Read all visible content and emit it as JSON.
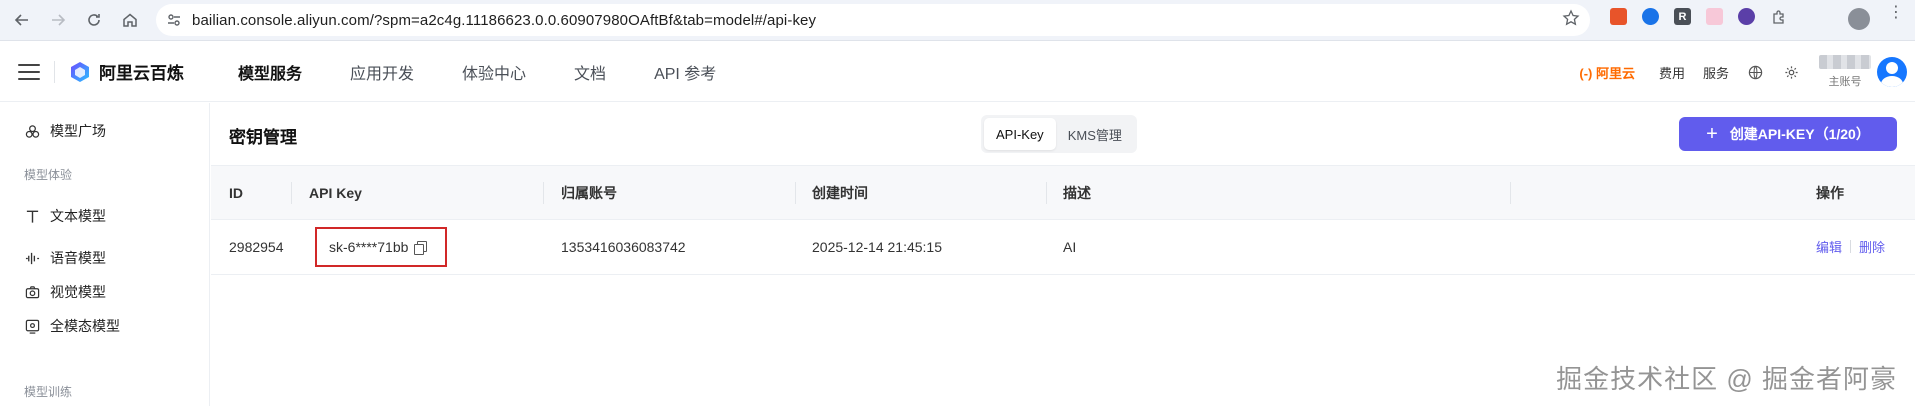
{
  "browser": {
    "url": "bailian.console.aliyun.com/?spm=a2c4g.11186623.0.0.60907980OAftBf&tab=model#/api-key",
    "ext_r_label": "R"
  },
  "header": {
    "logo_text": "阿里云百炼",
    "nav": [
      "模型服务",
      "应用开发",
      "体验中心",
      "文档",
      "API 参考"
    ],
    "aliyun_badge": "(-) 阿里云",
    "links": {
      "billing": "费用",
      "service": "服务"
    },
    "account_sub": "主账号"
  },
  "sidebar": {
    "items": [
      {
        "label": "模型广场",
        "icon": "model-plaza-icon"
      },
      {
        "label": "文本模型",
        "icon": "text-icon"
      },
      {
        "label": "语音模型",
        "icon": "audio-wave-icon"
      },
      {
        "label": "视觉模型",
        "icon": "camera-icon"
      },
      {
        "label": "全模态模型",
        "icon": "omni-icon"
      }
    ],
    "groups": [
      "模型体验",
      "模型训练"
    ]
  },
  "main": {
    "title": "密钥管理",
    "tabs": [
      {
        "label": "API-Key",
        "active": true
      },
      {
        "label": "KMS管理",
        "active": false
      }
    ],
    "create_button": "创建API-KEY（1/20）",
    "table": {
      "columns": [
        "ID",
        "API Key",
        "归属账号",
        "创建时间",
        "描述",
        "操作"
      ],
      "rows": [
        {
          "id": "2982954",
          "api_key": "sk-6****71bb",
          "account": "1353416036083742",
          "created": "2025-12-14 21:45:15",
          "desc": "AI",
          "edit": "编辑",
          "delete": "删除"
        }
      ]
    }
  },
  "watermark": "掘金技术社区 @ 掘金者阿豪",
  "colors": {
    "accent": "#615ced",
    "highlight_box": "#d12828",
    "brand_orange": "#ff6a00"
  }
}
